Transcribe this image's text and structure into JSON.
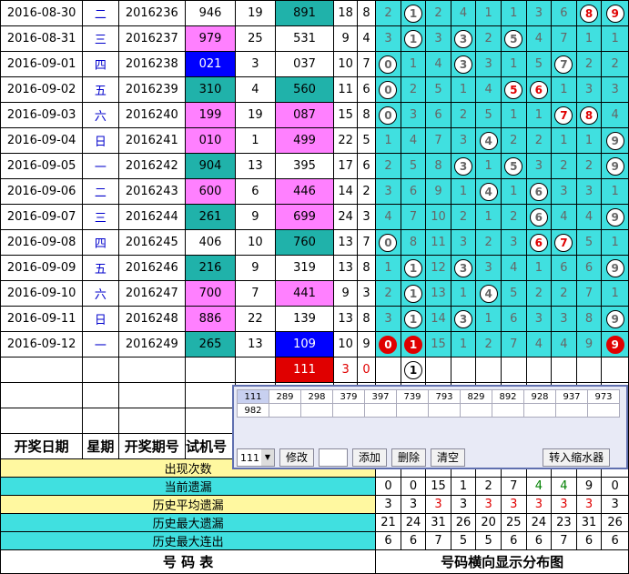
{
  "rows": [
    {
      "date": "2016-08-30",
      "week": "二",
      "issue": "2016236",
      "a": "946",
      "ac": "w",
      "b": "19",
      "c": "891",
      "cc": "t",
      "d": "18",
      "e": "8",
      "dist": [
        "2",
        "(1)",
        "2",
        "4",
        "1",
        "1",
        "3",
        "6",
        "R8",
        "R9"
      ]
    },
    {
      "date": "2016-08-31",
      "week": "三",
      "issue": "2016237",
      "a": "979",
      "ac": "p",
      "b": "25",
      "c": "531",
      "cc": "w",
      "d": "9",
      "e": "4",
      "dist": [
        "3",
        "(1)",
        "3",
        "(3)",
        "2",
        "(5)",
        "4",
        "7",
        "1",
        "1"
      ]
    },
    {
      "date": "2016-09-01",
      "week": "四",
      "issue": "2016238",
      "a": "021",
      "ac": "b",
      "b": "3",
      "c": "037",
      "cc": "w",
      "d": "10",
      "e": "7",
      "dist": [
        "(0)",
        "1",
        "4",
        "(3)",
        "3",
        "1",
        "5",
        "(7)",
        "2",
        "2"
      ]
    },
    {
      "date": "2016-09-02",
      "week": "五",
      "issue": "2016239",
      "a": "310",
      "ac": "t",
      "b": "4",
      "c": "560",
      "cc": "t",
      "d": "11",
      "e": "6",
      "dist": [
        "(0)",
        "2",
        "5",
        "1",
        "4",
        "R5",
        "R6",
        "1",
        "3",
        "3"
      ]
    },
    {
      "date": "2016-09-03",
      "week": "六",
      "issue": "2016240",
      "a": "199",
      "ac": "p",
      "b": "19",
      "c": "087",
      "cc": "p",
      "d": "15",
      "e": "8",
      "dist": [
        "(0)",
        "3",
        "6",
        "2",
        "5",
        "1",
        "1",
        "R7",
        "R8",
        "4"
      ]
    },
    {
      "date": "2016-09-04",
      "week": "日",
      "issue": "2016241",
      "a": "010",
      "ac": "p",
      "b": "1",
      "c": "499",
      "cc": "p",
      "d": "22",
      "e": "5",
      "dist": [
        "1",
        "4",
        "7",
        "3",
        "(4)",
        "2",
        "2",
        "1",
        "1",
        "(9)"
      ]
    },
    {
      "date": "2016-09-05",
      "week": "一",
      "issue": "2016242",
      "a": "904",
      "ac": "t",
      "b": "13",
      "c": "395",
      "cc": "w",
      "d": "17",
      "e": "6",
      "dist": [
        "2",
        "5",
        "8",
        "(3)",
        "1",
        "(5)",
        "3",
        "2",
        "2",
        "(9)"
      ]
    },
    {
      "date": "2016-09-06",
      "week": "二",
      "issue": "2016243",
      "a": "600",
      "ac": "p",
      "b": "6",
      "c": "446",
      "cc": "p",
      "d": "14",
      "e": "2",
      "dist": [
        "3",
        "6",
        "9",
        "1",
        "(4)",
        "1",
        "(6)",
        "3",
        "3",
        "1"
      ]
    },
    {
      "date": "2016-09-07",
      "week": "三",
      "issue": "2016244",
      "a": "261",
      "ac": "t",
      "b": "9",
      "c": "699",
      "cc": "p",
      "d": "24",
      "e": "3",
      "dist": [
        "4",
        "7",
        "10",
        "2",
        "1",
        "2",
        "(6)",
        "4",
        "4",
        "(9)"
      ]
    },
    {
      "date": "2016-09-08",
      "week": "四",
      "issue": "2016245",
      "a": "406",
      "ac": "w",
      "b": "10",
      "c": "760",
      "cc": "t",
      "d": "13",
      "e": "7",
      "dist": [
        "(0)",
        "8",
        "11",
        "3",
        "2",
        "3",
        "R6",
        "R7",
        "5",
        "1"
      ]
    },
    {
      "date": "2016-09-09",
      "week": "五",
      "issue": "2016246",
      "a": "216",
      "ac": "t",
      "b": "9",
      "c": "319",
      "cc": "w",
      "d": "13",
      "e": "8",
      "dist": [
        "1",
        "(1)",
        "12",
        "(3)",
        "3",
        "4",
        "1",
        "6",
        "6",
        "(9)"
      ]
    },
    {
      "date": "2016-09-10",
      "week": "六",
      "issue": "2016247",
      "a": "700",
      "ac": "p",
      "b": "7",
      "c": "441",
      "cc": "p",
      "d": "9",
      "e": "3",
      "dist": [
        "2",
        "(1)",
        "13",
        "1",
        "(4)",
        "5",
        "2",
        "2",
        "7",
        "1"
      ]
    },
    {
      "date": "2016-09-11",
      "week": "日",
      "issue": "2016248",
      "a": "886",
      "ac": "p",
      "b": "22",
      "c": "139",
      "cc": "w",
      "d": "13",
      "e": "8",
      "dist": [
        "3",
        "(1)",
        "14",
        "(3)",
        "1",
        "6",
        "3",
        "3",
        "8",
        "(9)"
      ]
    },
    {
      "date": "2016-09-12",
      "week": "一",
      "issue": "2016249",
      "a": "265",
      "ac": "t",
      "b": "13",
      "c": "109",
      "cc": "b",
      "d": "10",
      "e": "9",
      "dist": [
        "F0",
        "F1",
        "15",
        "1",
        "2",
        "7",
        "4",
        "4",
        "9",
        "F9"
      ]
    }
  ],
  "trial": {
    "value": "111",
    "sum": "3",
    "span": "0",
    "dist_hit": "1"
  },
  "headers": {
    "date": "开奖日期",
    "week": "星期",
    "issue": "开奖期号",
    "trial": "试机号"
  },
  "stats": [
    {
      "label": "出现次数",
      "values": [
        "",
        "",
        "",
        "",
        "",
        "",
        "",
        "",
        "",
        ""
      ]
    },
    {
      "label": "当前遗漏",
      "values": [
        "0",
        "0",
        "15",
        "1",
        "2",
        "7",
        "4",
        "4",
        "9",
        "0"
      ]
    },
    {
      "label": "历史平均遗漏",
      "values": [
        "3",
        "3",
        "3",
        "3",
        "3",
        "3",
        "3",
        "3",
        "3",
        "3"
      ]
    },
    {
      "label": "历史最大遗漏",
      "values": [
        "21",
        "24",
        "31",
        "26",
        "20",
        "25",
        "24",
        "23",
        "31",
        "26"
      ]
    },
    {
      "label": "历史最大连出",
      "values": [
        "6",
        "6",
        "7",
        "5",
        "5",
        "6",
        "6",
        "7",
        "6",
        "6"
      ]
    }
  ],
  "footer": {
    "left": "号 码 表",
    "right": "号码横向显示分布图"
  },
  "dialog": {
    "cells": [
      "111",
      "289",
      "298",
      "379",
      "397",
      "739",
      "793",
      "829",
      "892",
      "928",
      "937",
      "973",
      "982"
    ],
    "select_value": "111",
    "btn_modify": "修改",
    "btn_add": "添加",
    "btn_delete": "删除",
    "btn_clear": "清空",
    "btn_shrink": "转入缩水器"
  },
  "colors": {
    "pink": "#ff80ff",
    "teal": "#20b2aa",
    "blue": "#0000ff",
    "cyan": "#40e0e0",
    "red": "#e00000"
  }
}
